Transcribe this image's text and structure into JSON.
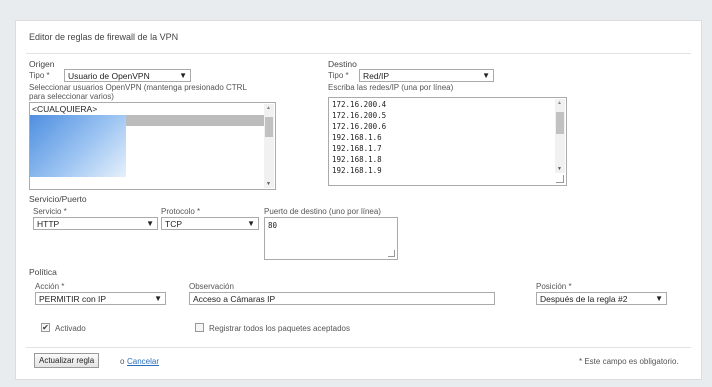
{
  "form": {
    "title": "Editor de reglas de firewall de la VPN",
    "required_note": "* Este campo es obligatorio."
  },
  "origen": {
    "heading": "Origen",
    "tipo_label": "Tipo *",
    "tipo_value": "Usuario de OpenVPN",
    "help_line1": "Seleccionar usuarios OpenVPN (mantenga presionado CTRL",
    "help_line2": "para seleccionar varios)",
    "users": [
      "<CUALQUIERA>"
    ]
  },
  "destino": {
    "heading": "Destino",
    "tipo_label": "Tipo *",
    "tipo_value": "Red/IP",
    "help": "Escriba las redes/IP (una por línea)",
    "ips": [
      "172.16.200.4",
      "172.16.200.5",
      "172.16.200.6",
      "192.168.1.6",
      "192.168.1.7",
      "192.168.1.8",
      "192.168.1.9"
    ]
  },
  "servicio": {
    "heading": "Servicio/Puerto",
    "servicio_label": "Servicio *",
    "servicio_value": "HTTP",
    "protocolo_label": "Protocolo *",
    "protocolo_value": "TCP",
    "puerto_label": "Puerto de destino (uno por línea)",
    "puerto_value": "80"
  },
  "politica": {
    "heading": "Política",
    "accion_label": "Acción *",
    "accion_value": "PERMITIR con IP",
    "observacion_label": "Observación",
    "observacion_value": "Acceso a Cámaras IP",
    "posicion_label": "Posición *",
    "posicion_value": "Después de la regla #2",
    "activado_label": "Activado",
    "activado_checked": true,
    "registrar_label": "Registrar todos los paquetes aceptados",
    "registrar_checked": false
  },
  "actions": {
    "update_label": "Actualizar regla",
    "or_label": "o",
    "cancel_label": "Cancelar"
  },
  "icons": {
    "dropdown": "▼",
    "check": "✔",
    "scroll_up": "▲",
    "scroll_down": "▼"
  }
}
